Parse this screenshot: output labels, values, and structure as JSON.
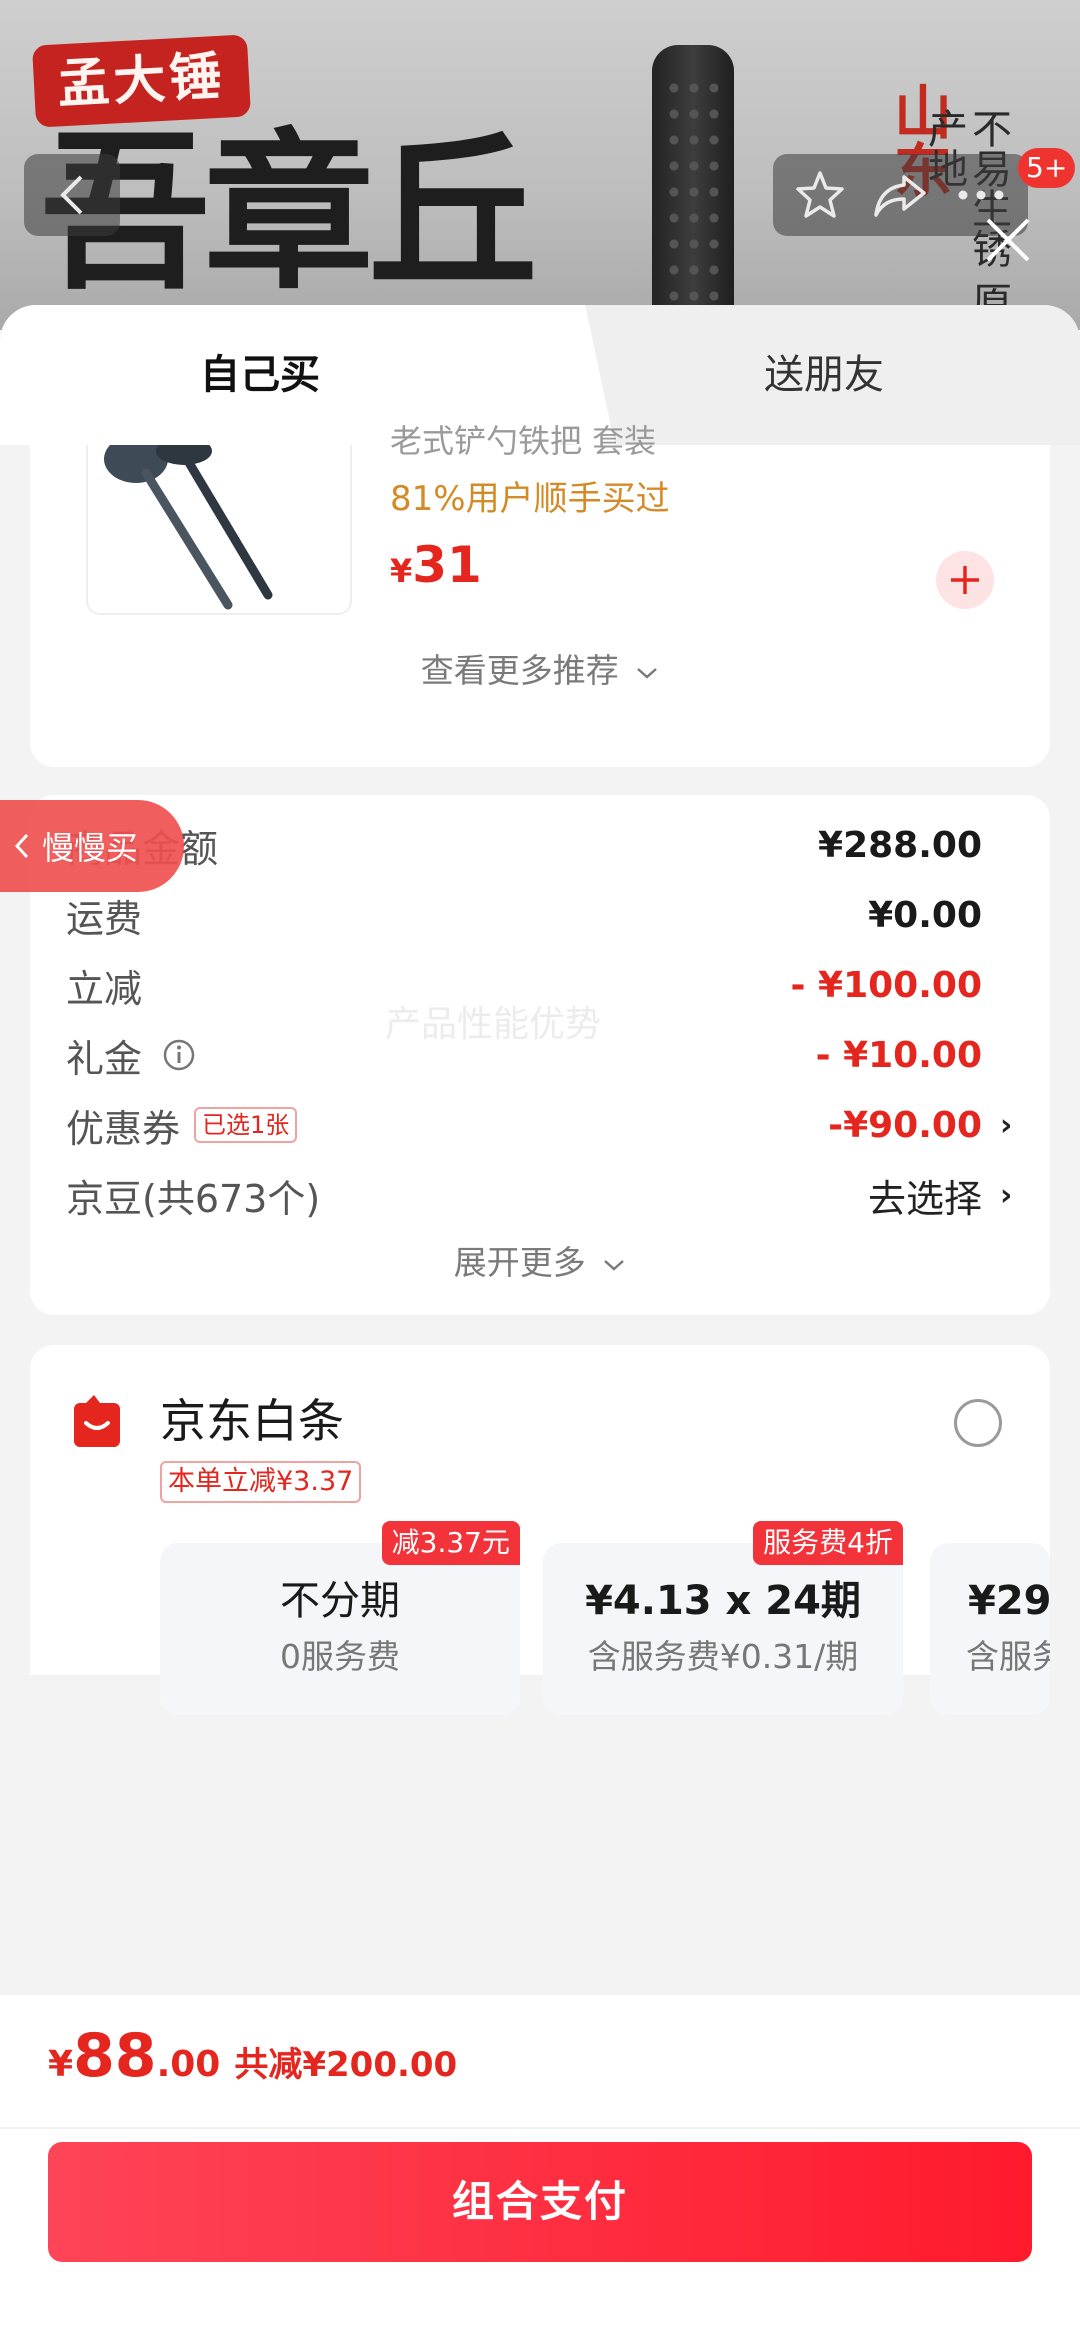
{
  "banner": {
    "seal_text": "孟大锤",
    "brush_text": "吾章丘",
    "vertical_red": "山东",
    "vertical_dark": "不易生锈 原产地",
    "cart_badge": "5+"
  },
  "tabs": {
    "self_buy": "自己买",
    "gift_friend": "送朋友"
  },
  "recommendation": {
    "title": "老式铲勺铁把 套装",
    "tip": "81%用户顺手买过",
    "currency": "¥",
    "price": "31",
    "more_link": "查看更多推荐"
  },
  "floating": {
    "slow_buy": "慢慢买",
    "watermark": "产品性能优势"
  },
  "price_rows": [
    {
      "label": "商品金额",
      "value": "¥288.00"
    },
    {
      "label": "运费",
      "value": "¥0.00"
    },
    {
      "label": "立减",
      "value": "- ¥100.00"
    },
    {
      "label": "礼金",
      "value": "- ¥10.00"
    },
    {
      "label": "优惠券",
      "tag": "已选1张",
      "value": "-¥90.00"
    },
    {
      "label": "京豆(共673个)",
      "value": "去选择"
    }
  ],
  "expand_more": "展开更多",
  "baitiao": {
    "title": "京东白条",
    "promo": "本单立减¥3.37",
    "plans": [
      {
        "title": "不分期",
        "sub": "0服务费",
        "tag": "减3.37元"
      },
      {
        "title": "¥4.13 x 24期",
        "sub": "含服务费¥0.31/期",
        "tag": "服务费4折"
      },
      {
        "title": "¥29",
        "sub": "含服务"
      }
    ]
  },
  "summary": {
    "currency": "¥",
    "amount_int": "88",
    "amount_dec": ".00",
    "saved": "共减¥200.00"
  },
  "pay_button": "组合支付",
  "colors": {
    "accent_red": "#e4261e",
    "tip_orange": "#d48a25",
    "pay_gradient_start": "#fe4457",
    "pay_gradient_end": "#ff1a2c"
  }
}
